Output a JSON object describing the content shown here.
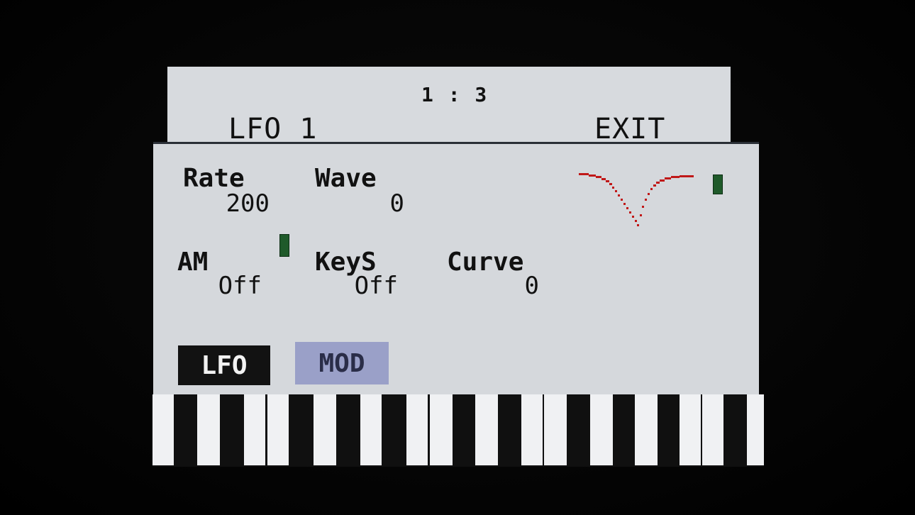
{
  "header": {
    "page_counter": "1 : 3",
    "title": "LFO 1",
    "exit_label": "EXIT"
  },
  "params": {
    "rate": {
      "label": "Rate",
      "value": "200"
    },
    "wave": {
      "label": "Wave",
      "value": "0"
    },
    "am": {
      "label": "AM",
      "value": "Off"
    },
    "keys": {
      "label": "KeyS",
      "value": "Off"
    },
    "curve": {
      "label": "Curve",
      "value": "0"
    }
  },
  "tabs": {
    "lfo": "LFO",
    "mod": "MOD"
  },
  "colors": {
    "screen_bg": "#d7dade",
    "wave_color": "#c01818",
    "meter_color": "#1f5a2a",
    "mod_tab_bg": "#9aa0c8"
  },
  "icons": {
    "wave_preview": "lfo-waveform-preview",
    "meter": "level-meter"
  }
}
